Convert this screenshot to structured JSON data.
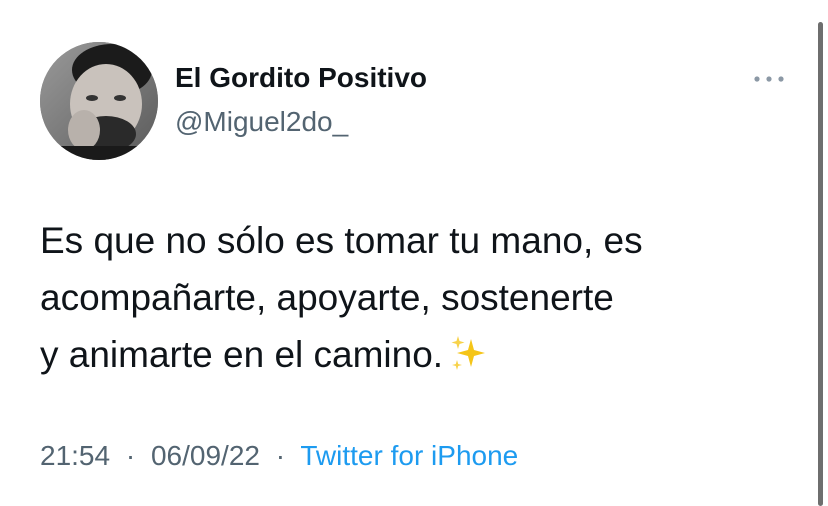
{
  "tweet": {
    "author": {
      "display_name": "El Gordito Positivo",
      "handle": "@Miguel2do_",
      "avatar_icon": "profile-photo"
    },
    "more_icon": "more-options-icon",
    "text_lines": [
      "Es que no sólo es tomar tu mano, es",
      "acompañarte, apoyarte, sostenerte",
      "y animarte en el camino."
    ],
    "emoji": "sparkles-emoji",
    "time": "21:54",
    "separator": "·",
    "date": "06/09/22",
    "source": "Twitter for iPhone"
  },
  "colors": {
    "text_primary": "#0f1419",
    "text_secondary": "#536471",
    "link": "#1d9bf0",
    "sparkle": "#f5c518"
  }
}
